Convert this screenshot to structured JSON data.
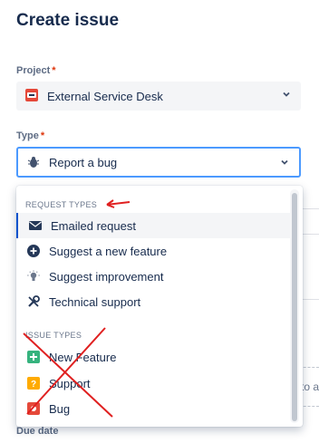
{
  "header": {
    "title": "Create issue"
  },
  "project": {
    "label": "Project",
    "required_mark": "*",
    "value": "External Service Desk"
  },
  "type": {
    "label": "Type",
    "required_mark": "*",
    "value": "Report a bug"
  },
  "background": {
    "cut_text": "to a",
    "due_label": "Due date"
  },
  "dropdown": {
    "request_types": {
      "heading": "REQUEST TYPES",
      "items": [
        {
          "label": "Emailed request",
          "icon": "envelope-icon"
        },
        {
          "label": "Suggest a new feature",
          "icon": "plus-circle-icon"
        },
        {
          "label": "Suggest improvement",
          "icon": "lightbulb-icon"
        },
        {
          "label": "Technical support",
          "icon": "wrench-icon"
        }
      ]
    },
    "issue_types": {
      "heading": "ISSUE TYPES",
      "items": [
        {
          "label": "New Feature",
          "icon": "green-plus-icon"
        },
        {
          "label": "Support",
          "icon": "question-icon"
        },
        {
          "label": "Bug",
          "icon": "bug-icon"
        }
      ]
    }
  },
  "colors": {
    "accent": "#0052cc",
    "annotation": "#e02020",
    "required": "#de350b",
    "new_feature": "#36b37e",
    "support": "#ffab00",
    "bug": "#e5493a"
  }
}
